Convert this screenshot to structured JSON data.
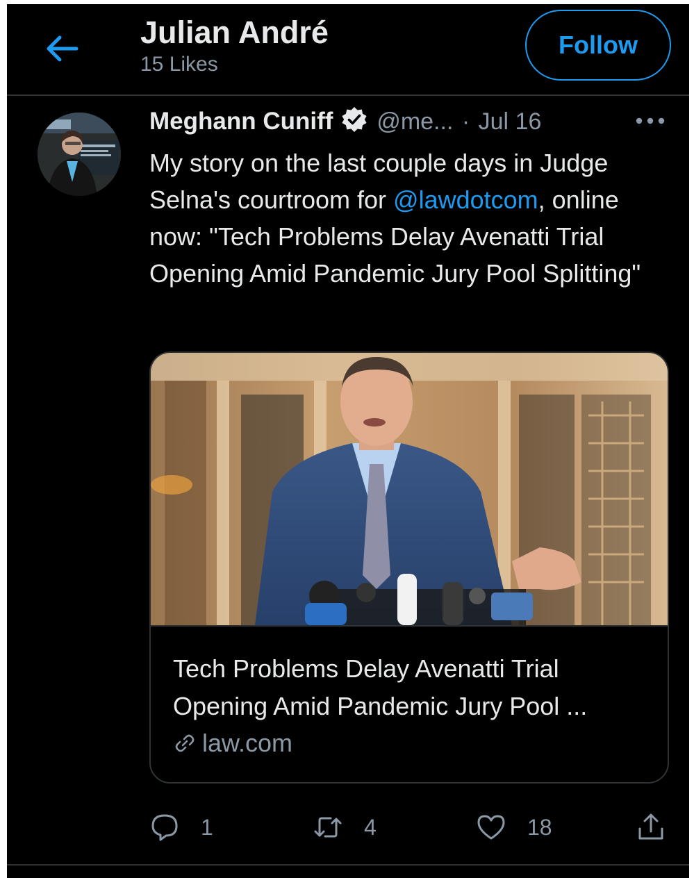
{
  "header": {
    "title": "Julian André",
    "subtitle": "15 Likes",
    "follow_label": "Follow"
  },
  "tweet": {
    "author_name": "Meghann Cuniff",
    "handle": "@me...",
    "separator": "·",
    "date": "Jul 16",
    "text_before": "My story on the last couple days in Judge Selna's courtroom for ",
    "mention": "@lawdotcom",
    "text_after": ", online now: \"Tech Problems Delay Avenatti Trial Opening Amid Pandemic Jury Pool Splitting\"",
    "card": {
      "title": "Tech Problems Delay Avenatti Trial Opening Amid Pandemic Jury Pool ...",
      "domain": "law.com"
    },
    "actions": {
      "reply_count": "1",
      "retweet_count": "4",
      "like_count": "18"
    }
  },
  "icons": {
    "back": "arrow-left-icon",
    "verified": "verified-badge-icon",
    "more": "more-horizontal-icon",
    "link": "link-icon",
    "reply": "reply-icon",
    "retweet": "retweet-icon",
    "like": "heart-icon",
    "share": "share-icon"
  },
  "colors": {
    "background": "#000000",
    "accent": "#1d9bf0",
    "text_primary": "#e7e9ea",
    "text_secondary": "#8b98a5",
    "border": "#2f3336"
  }
}
